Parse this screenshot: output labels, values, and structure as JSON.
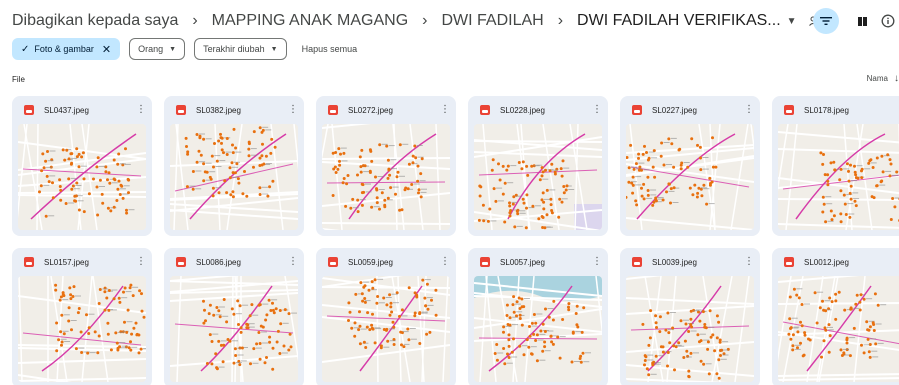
{
  "breadcrumb": {
    "items": [
      "Dibagikan kepada saya",
      "MAPPING ANAK MAGANG",
      "DWI FADILAH",
      "DWI FADILAH VERIFIKAS..."
    ]
  },
  "toolbar": {
    "filter_icon": "filter-icon",
    "view_icon": "grid-view-icon",
    "info_icon": "info-icon"
  },
  "filters": {
    "type_chip": "Foto & gambar",
    "people_chip": "Orang",
    "modified_chip": "Terakhir diubah",
    "clear_all": "Hapus semua"
  },
  "section": {
    "label": "File",
    "sort_label": "Nama"
  },
  "colors": {
    "accent": "#c2e7ff",
    "card_bg": "#e9eef6",
    "image_icon": "#ea4335",
    "route": "#d63ba8",
    "marker": "#e8700f"
  },
  "files": [
    {
      "name": "SL0437.jpeg"
    },
    {
      "name": "SL0382.jpeg"
    },
    {
      "name": "SL0272.jpeg"
    },
    {
      "name": "SL0228.jpeg"
    },
    {
      "name": "SL0227.jpeg"
    },
    {
      "name": "SL0178.jpeg"
    },
    {
      "name": "SL0157.jpeg"
    },
    {
      "name": "SL0086.jpeg"
    },
    {
      "name": "SL0059.jpeg"
    },
    {
      "name": "SL0057.jpeg"
    },
    {
      "name": "SL0039.jpeg"
    },
    {
      "name": "SL0012.jpeg"
    }
  ]
}
